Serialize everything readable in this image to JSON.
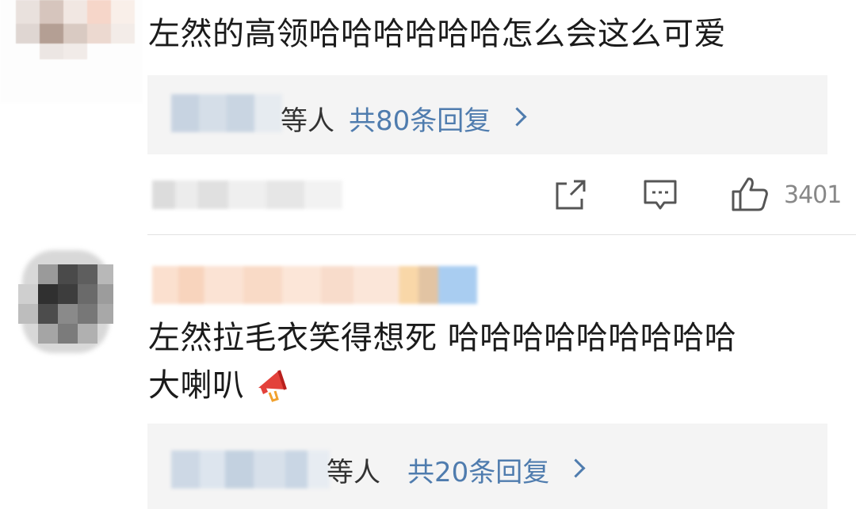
{
  "comments": [
    {
      "text": "左然的高领哈哈哈哈哈哈怎么会这么可爱",
      "replies": {
        "suffix": "等人",
        "count_label": "共80条回复"
      },
      "actions": {
        "like_count": "3401"
      }
    },
    {
      "line1": "左然拉毛衣笑得想死 哈哈哈哈哈哈哈哈哈",
      "line2": "大喇叭",
      "replies": {
        "suffix": "等人",
        "count_label": "共20条回复"
      }
    }
  ],
  "icons": {
    "share": "share-icon",
    "comment": "comment-icon",
    "like": "thumbs-up-icon",
    "megaphone": "megaphone-emoji",
    "chevron": "chevron-right-icon"
  },
  "colors": {
    "link": "#4f7cae",
    "reply_bg": "#f4f4f4",
    "text": "#1b1b1b",
    "meta": "#888888"
  }
}
